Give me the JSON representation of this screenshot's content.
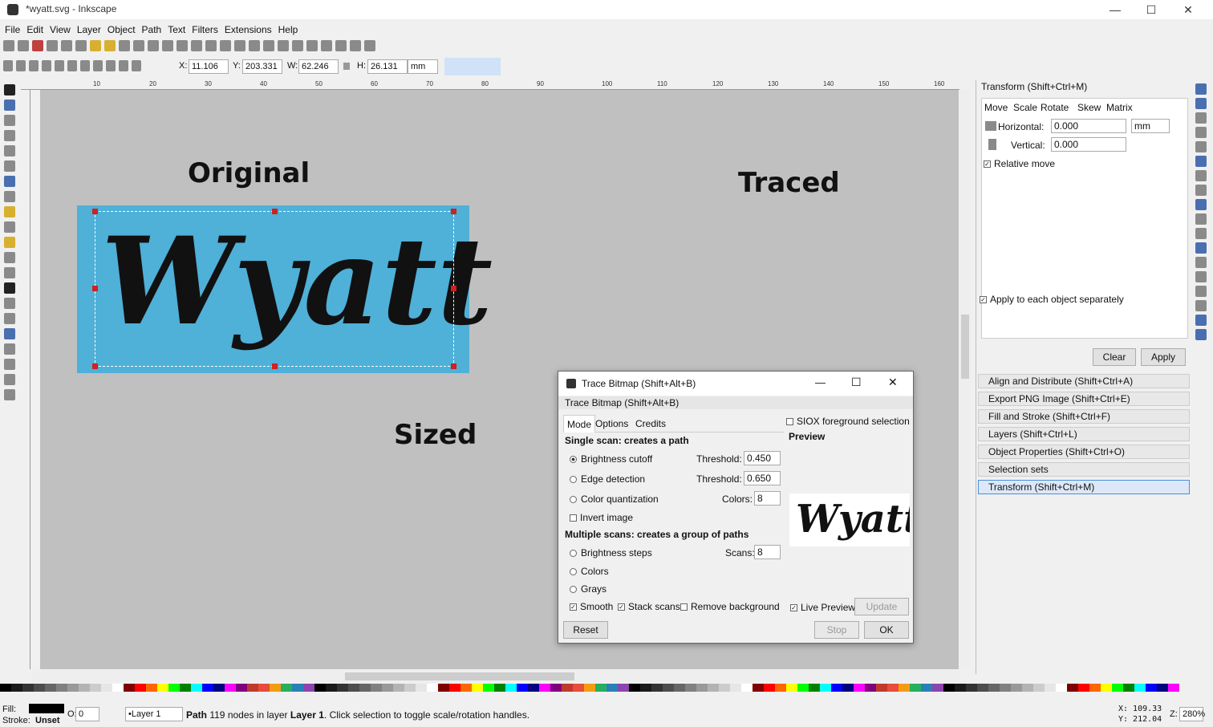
{
  "window": {
    "title": "*wyatt.svg - Inkscape",
    "min": "—",
    "max": "☐",
    "close": "✕"
  },
  "menu": [
    "File",
    "Edit",
    "View",
    "Layer",
    "Object",
    "Path",
    "Text",
    "Filters",
    "Extensions",
    "Help"
  ],
  "toolcontrols": {
    "x_label": "X:",
    "x": "11.106",
    "y_label": "Y:",
    "y": "203.331",
    "w_label": "W:",
    "w": "62.246",
    "h_label": "H:",
    "h": "26.131",
    "unit": "mm"
  },
  "ruler": [
    "10",
    "20",
    "30",
    "40",
    "50",
    "60",
    "70",
    "80",
    "90",
    "100",
    "110",
    "120",
    "130",
    "140",
    "150",
    "160"
  ],
  "canvas": {
    "original": "Original",
    "traced": "Traced",
    "sized": "Sized",
    "bitmap_text": "Wyatt"
  },
  "dialog": {
    "title": "Trace Bitmap (Shift+Alt+B)",
    "subtitle": "Trace Bitmap (Shift+Alt+B)",
    "tabs": [
      "Mode",
      "Options",
      "Credits"
    ],
    "siox": "SIOX foreground selection",
    "single_scan": "Single scan: creates a path",
    "brightness_cutoff": "Brightness cutoff",
    "threshold_label": "Threshold:",
    "threshold1": "0.450",
    "edge_detection": "Edge detection",
    "threshold2": "0.650",
    "color_quant": "Color quantization",
    "colors_label": "Colors:",
    "colors_val": "8",
    "invert": "Invert image",
    "multiple_scans": "Multiple scans: creates a group of paths",
    "brightness_steps": "Brightness steps",
    "scans_label": "Scans:",
    "scans_val": "8",
    "colors": "Colors",
    "grays": "Grays",
    "smooth": "Smooth",
    "stack": "Stack scans",
    "remove_bg": "Remove background",
    "preview": "Preview",
    "preview_text": "Wyatt",
    "live_preview": "Live Preview",
    "update": "Update",
    "reset": "Reset",
    "stop": "Stop",
    "ok": "OK",
    "check": "✓"
  },
  "transform": {
    "title": "Transform (Shift+Ctrl+M)",
    "tabs": [
      "Move",
      "Scale",
      "Rotate",
      "Skew",
      "Matrix"
    ],
    "horizontal_label": "Horizontal:",
    "horizontal": "0.000",
    "unit": "mm",
    "vertical_label": "Vertical:",
    "vertical": "0.000",
    "relative": "Relative move",
    "apply_each": "Apply to each object separately",
    "clear": "Clear",
    "apply": "Apply"
  },
  "docks": [
    "Align and Distribute (Shift+Ctrl+A)",
    "Export PNG Image (Shift+Ctrl+E)",
    "Fill and Stroke (Shift+Ctrl+F)",
    "Layers (Shift+Ctrl+L)",
    "Object Properties (Shift+Ctrl+O)",
    "Selection sets",
    "Transform (Shift+Ctrl+M)"
  ],
  "status": {
    "fill_label": "Fill:",
    "stroke_label": "Stroke:",
    "stroke_val": "Unset",
    "opacity_label": "O:",
    "opacity": "0",
    "layer": "•Layer 1",
    "msg_bold1": "Path",
    "msg1": " 119 nodes in layer ",
    "msg_bold2": "Layer 1",
    ".": "",
    "msg2": ". Click selection to toggle scale/rotation handles.",
    "x_coord": "X:  109.33",
    "y_coord": "Y:  212.04",
    "zoom_label": "Z:",
    "zoom": "280%"
  },
  "palette_colors": [
    "#000000",
    "#1a1a1a",
    "#333333",
    "#4d4d4d",
    "#666666",
    "#808080",
    "#999999",
    "#b3b3b3",
    "#cccccc",
    "#e6e6e6",
    "#ffffff",
    "#800000",
    "#ff0000",
    "#ff6600",
    "#ffff00",
    "#00ff00",
    "#008000",
    "#00ffff",
    "#0000ff",
    "#000080",
    "#ff00ff",
    "#800080",
    "#c0392b",
    "#e74c3c",
    "#f39c12",
    "#27ae60",
    "#2980b9",
    "#8e44ad"
  ]
}
